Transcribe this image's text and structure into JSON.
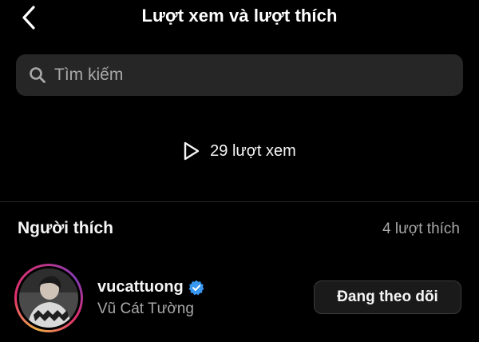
{
  "header": {
    "title": "Lượt xem và lượt thích",
    "back_icon": "chevron-left-icon"
  },
  "search": {
    "placeholder": "Tìm kiếm",
    "value": "",
    "icon": "search-icon"
  },
  "views": {
    "icon": "play-icon",
    "text": "29 lượt xem"
  },
  "likers": {
    "title": "Người thích",
    "count_text": "4 lượt thích",
    "users": [
      {
        "username": "vucattuong",
        "verified": true,
        "full_name": "Vũ Cát Tường",
        "button_label": "Đang theo dõi"
      }
    ]
  },
  "colors": {
    "background": "#000000",
    "search_bg": "#262626",
    "secondary_text": "#a8a8a8",
    "verified_blue": "#3897f0"
  }
}
